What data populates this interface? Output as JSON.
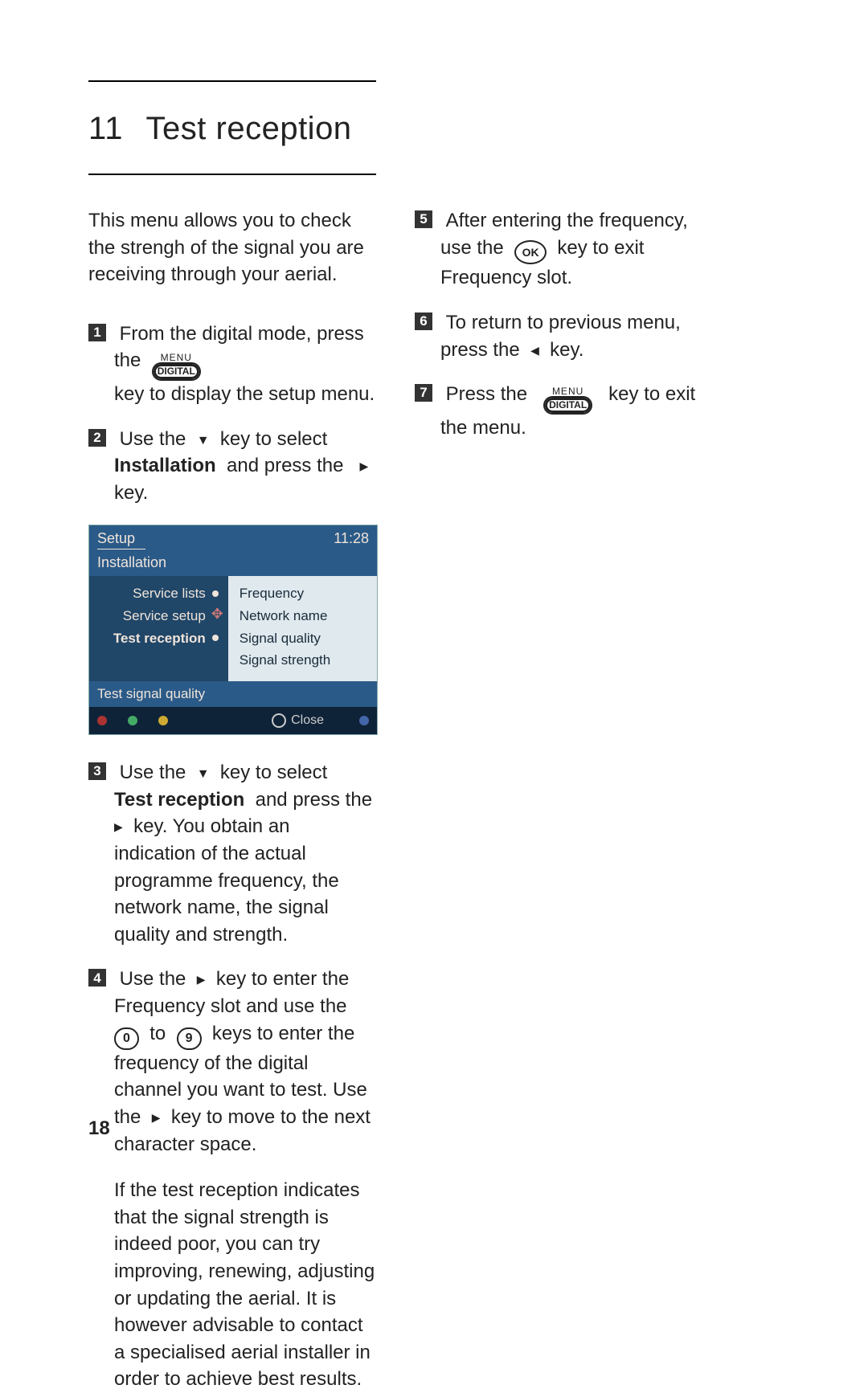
{
  "page_number": "18",
  "title": {
    "number": "11",
    "text": "Test reception"
  },
  "intro": "This menu allows you to check the strengh of the signal you are receiving through your aerial.",
  "left_steps": {
    "s1_a": " From the digital mode, press the ",
    "s1_b": "key to display the setup menu.",
    "s2_a": " Use the ",
    "s2_b": " key to select ",
    "s2_bold": "Installation",
    "s2_c": " and press the  ",
    "s2_d": "  key.",
    "s3_a": " Use the ",
    "s3_b": " key to select ",
    "s3_bold": "Test reception",
    "s3_c": " and press the ",
    "s3_d": " key. You obtain an indication of the actual programme frequency, the network name, the signal quality and strength.",
    "s4_a": " Use the ",
    "s4_b": " key to enter the Frequency slot and use the ",
    "s4_c": " to ",
    "s4_d": " keys to enter the frequency of the digital channel you want to test. Use the ",
    "s4_e": " key to move to the next character space.",
    "advice": "If the test reception indicates that the signal strength is indeed poor, you can try improving, renewing, adjusting or updating the aerial. It is however advisable to contact a specialised aerial installer in order to achieve best results."
  },
  "right_steps": {
    "s5_a": " After entering the frequency, use the ",
    "s5_b": " key to exit Frequency slot.",
    "s6_a": " To return to previous menu, press the ",
    "s6_b": " key.",
    "s7_a": " Press the  ",
    "s7_b": "  key to exit the menu."
  },
  "keys": {
    "menu": "MENU",
    "digital": "DIGITAL",
    "ok": "OK",
    "zero": "0",
    "nine": "9"
  },
  "bullets": {
    "b1": "1",
    "b2": "2",
    "b3": "3",
    "b4": "4",
    "b5": "5",
    "b6": "6",
    "b7": "7"
  },
  "menu": {
    "title": "Setup",
    "time": "11:28",
    "subtitle": "Installation",
    "left": {
      "r1": "Service lists",
      "r2": "Service setup",
      "r3": "Test reception"
    },
    "right": {
      "r1": "Frequency",
      "r2": "Network name",
      "r3": "Signal quality",
      "r4": "Signal strength"
    },
    "footer": "Test signal quality",
    "close": "Close"
  }
}
